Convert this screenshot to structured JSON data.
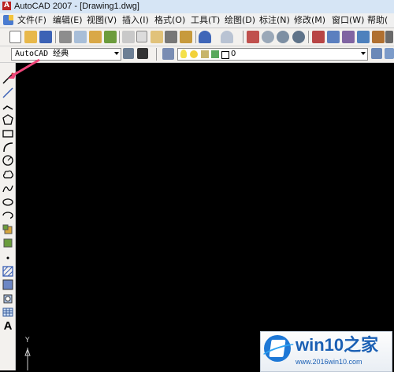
{
  "window": {
    "title": "AutoCAD 2007 - [Drawing1.dwg]"
  },
  "menubar": {
    "items": [
      "文件(F)",
      "编辑(E)",
      "视图(V)",
      "插入(I)",
      "格式(O)",
      "工具(T)",
      "绘图(D)",
      "标注(N)",
      "修改(M)",
      "窗口(W)",
      "帮助("
    ]
  },
  "toolbar_standard": {
    "icons": [
      "new-icon",
      "open-icon",
      "save-icon",
      "plot-icon",
      "plot-preview-icon",
      "publish-icon",
      "cut-icon",
      "copy-icon",
      "paste-icon",
      "match-properties-icon",
      "undo-icon",
      "redo-icon",
      "pan-icon",
      "zoom-realtime-icon",
      "zoom-window-icon",
      "zoom-previous-icon",
      "properties-icon",
      "design-center-icon",
      "tool-palettes-icon",
      "sheet-set-icon"
    ]
  },
  "toolbar_workspace": {
    "workspace_value": "AutoCAD 经典",
    "layer_value": "0",
    "layer_state_icons": [
      "lightbulb-icon",
      "sun-icon",
      "lock-icon",
      "color-swatch-icon"
    ]
  },
  "draw_toolbar": {
    "tools": [
      "line-icon",
      "construction-line-icon",
      "polyline-icon",
      "polygon-icon",
      "rectangle-icon",
      "arc-icon",
      "circle-icon",
      "revision-cloud-icon",
      "spline-icon",
      "ellipse-icon",
      "ellipse-arc-icon",
      "insert-block-icon",
      "make-block-icon",
      "point-icon",
      "hatch-icon",
      "gradient-icon",
      "region-icon",
      "table-icon",
      "multiline-text-icon"
    ],
    "text_tool_label": "A"
  },
  "ucs": {
    "y_label": "Y"
  },
  "watermark": {
    "title": "win10之家",
    "url": "www.2016win10.com"
  },
  "colors": {
    "canvas": "#000000",
    "annotation_arrow": "#f0467a",
    "watermark_blue": "#1a5fb4"
  }
}
